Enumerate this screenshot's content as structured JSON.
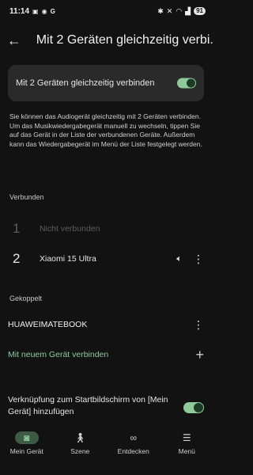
{
  "status_bar": {
    "time": "11:14",
    "battery": "91"
  },
  "header": {
    "title": "Mit 2 Geräten gleichzeitig verbi..."
  },
  "toggle": {
    "label": "Mit 2 Geräten gleichzeitig verbinden",
    "state": "on"
  },
  "description": "Sie können das Audiogerät gleichzeitig mit 2 Geräten verbinden. Um das Musikwiedergabegerät manuell zu wechseln, tippen Sie auf das Gerät in der Liste der verbundenen Geräte. Außerdem kann das Wiedergabegerät im Menü der Liste festgelegt werden.",
  "connected": {
    "label": "Verbunden",
    "items": [
      {
        "num": "1",
        "name": "Nicht verbunden"
      },
      {
        "num": "2",
        "name": "Xiaomi 15 Ultra"
      }
    ]
  },
  "paired": {
    "label": "Gekoppelt",
    "device": "HUAWEIMATEBOOK",
    "connect_new": "Mit neuem Gerät verbinden"
  },
  "shortcut": {
    "label": "Verknüpfung zum Startbildschirm von [Mein Gerät] hinzufügen",
    "state": "on"
  },
  "nav": {
    "items": [
      {
        "label": "Mein Gerät",
        "icon": "device-icon"
      },
      {
        "label": "Szene",
        "icon": "person-icon"
      },
      {
        "label": "Entdecken",
        "icon": "binoculars-icon"
      },
      {
        "label": "Menü",
        "icon": "menu-icon"
      }
    ],
    "active": "Mein Gerät"
  },
  "colors": {
    "accent": "#8fc99a",
    "background": "#121212",
    "card": "#2a2a2a"
  }
}
